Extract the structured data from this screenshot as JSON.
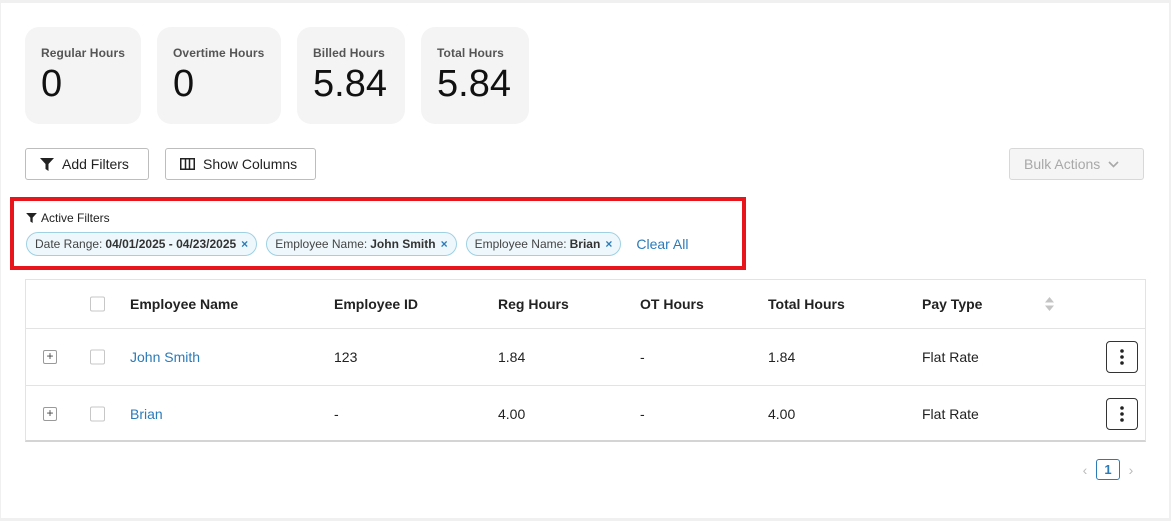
{
  "stats": [
    {
      "label": "Regular Hours",
      "value": "0"
    },
    {
      "label": "Overtime Hours",
      "value": "0"
    },
    {
      "label": "Billed Hours",
      "value": "5.84"
    },
    {
      "label": "Total Hours",
      "value": "5.84"
    }
  ],
  "toolbar": {
    "add_filters": "Add Filters",
    "show_columns": "Show Columns",
    "bulk_actions": "Bulk Actions"
  },
  "active_filters": {
    "title": "Active Filters",
    "chips": [
      {
        "key": "Date Range:",
        "value": "04/01/2025 - 04/23/2025"
      },
      {
        "key": "Employee Name:",
        "value": "John Smith"
      },
      {
        "key": "Employee Name:",
        "value": "Brian"
      }
    ],
    "clear_all": "Clear All"
  },
  "table": {
    "columns": [
      "Employee Name",
      "Employee ID",
      "Reg Hours",
      "OT Hours",
      "Total Hours",
      "Pay Type"
    ],
    "rows": [
      {
        "name": "John Smith",
        "id": "123",
        "reg": "1.84",
        "ot": "-",
        "total": "1.84",
        "pay_type": "Flat Rate"
      },
      {
        "name": "Brian",
        "id": "-",
        "reg": "4.00",
        "ot": "-",
        "total": "4.00",
        "pay_type": "Flat Rate"
      }
    ]
  },
  "pagination": {
    "current_page": "1"
  },
  "icons": {
    "filter": "filter-icon",
    "columns": "columns-icon",
    "chevron": "chevron-down-icon",
    "kebab": "more-vertical-icon",
    "sort": "sort-icon",
    "expand": "plus-box-icon"
  },
  "colors": {
    "accent": "#2b7bb9",
    "highlight": "#e8151c",
    "chip_bg": "#eef8fc"
  }
}
